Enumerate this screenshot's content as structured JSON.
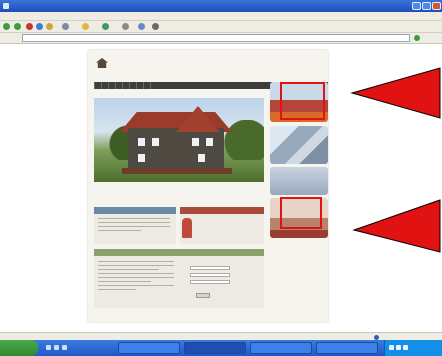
{
  "browser": {
    "title": "",
    "menu": [
      "",
      "",
      "",
      "",
      "",
      ""
    ],
    "address_label": "",
    "address": "",
    "go_label": ""
  },
  "site": {
    "brand": "",
    "tagline": "",
    "nav": [
      "",
      "",
      "",
      "",
      "",
      "",
      "",
      "",
      ""
    ],
    "hero_caption": "",
    "welcome_title": "",
    "welcome_sub": "",
    "panel1_title": "",
    "panel2_title": "",
    "promo_text": "",
    "info_title": "",
    "form_title": "",
    "send_label": "",
    "thumbs": [
      {
        "caption": ""
      },
      {
        "caption": ""
      },
      {
        "caption": ""
      },
      {
        "caption": ""
      }
    ]
  },
  "status": {
    "zone": ""
  },
  "taskbar": {
    "start_label": "",
    "tasks": [
      "",
      "",
      "",
      ""
    ],
    "clock": ""
  },
  "colors": {
    "annotation": "#e11212",
    "titlebar": "#1c4fb8",
    "taskbar": "#2158c7",
    "start": "#2f8a2f"
  }
}
